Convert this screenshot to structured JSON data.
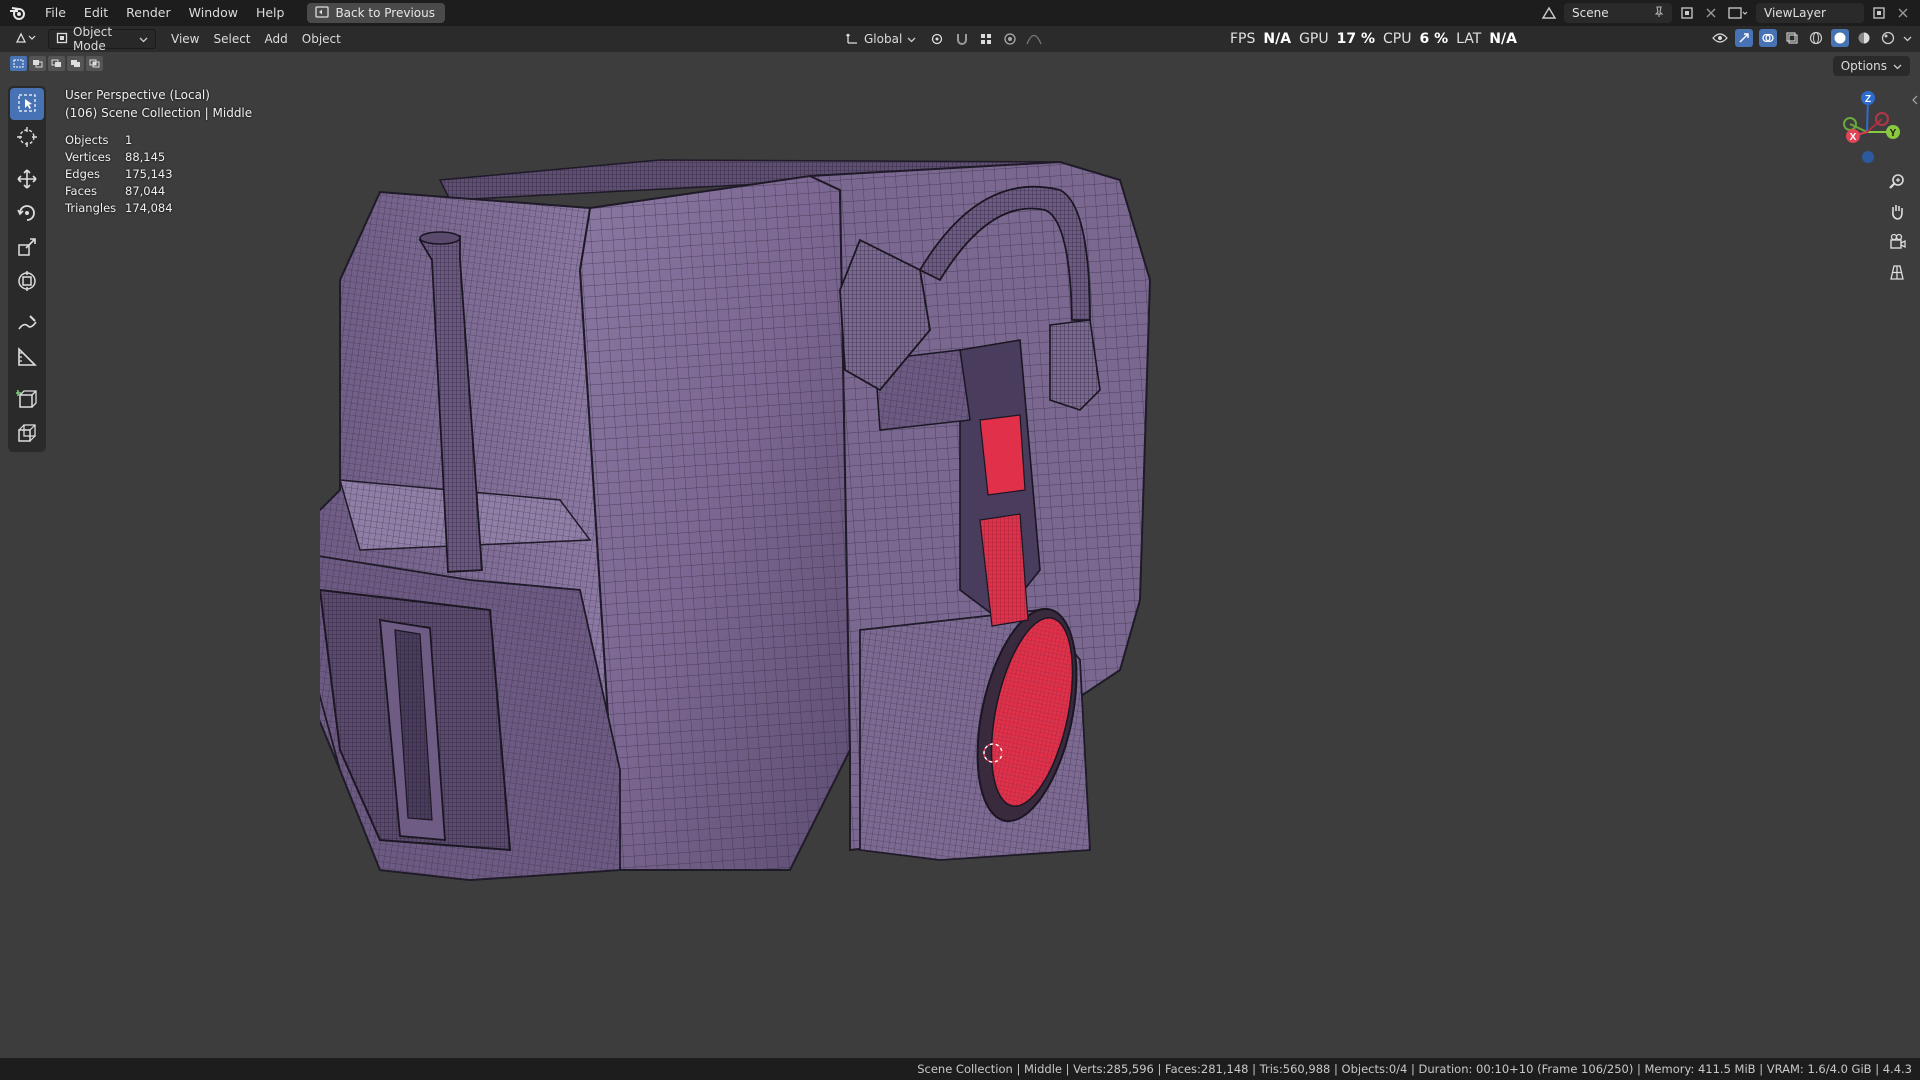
{
  "menu": {
    "items": [
      "File",
      "Edit",
      "Render",
      "Window",
      "Help"
    ],
    "back_label": "Back to Previous"
  },
  "topright": {
    "scene_label": "Scene",
    "viewlayer_label": "ViewLayer"
  },
  "header": {
    "mode_label": "Object Mode",
    "menus": [
      "View",
      "Select",
      "Add",
      "Object"
    ],
    "transform_orientation": "Global",
    "perf": {
      "fps_label": "FPS",
      "fps_value": "N/A",
      "gpu_label": "GPU",
      "gpu_value": "17 %",
      "cpu_label": "CPU",
      "cpu_value": "6 %",
      "lat_label": "LAT",
      "lat_value": "N/A"
    },
    "options_label": "Options"
  },
  "viewport": {
    "perspective": "User Perspective (Local)",
    "collection": "(106) Scene Collection | Middle",
    "stats": [
      {
        "label": "Objects",
        "value": "1"
      },
      {
        "label": "Vertices",
        "value": "88,145"
      },
      {
        "label": "Edges",
        "value": "175,143"
      },
      {
        "label": "Faces",
        "value": "87,044"
      },
      {
        "label": "Triangles",
        "value": "174,084"
      }
    ],
    "gizmo": {
      "x": "X",
      "y": "Y",
      "z": "Z"
    }
  },
  "toolbar": {
    "tools": [
      "select-box",
      "cursor",
      "move",
      "rotate",
      "scale",
      "transform",
      "annotate",
      "measure",
      "add-cube",
      "extrude"
    ]
  },
  "statusbar": {
    "text": "Scene Collection | Middle | Verts:285,596 | Faces:281,148 | Tris:560,988 | Objects:0/4 | Duration: 00:10+10 (Frame 106/250) | Memory: 411.5 MiB | VRAM: 1.6/4.0 GiB | 4.4.3"
  },
  "colors": {
    "accent": "#4772b3",
    "model_body": "#7a6690",
    "model_highlight": "#e0304a",
    "viewport_bg": "#3d3d3d"
  }
}
